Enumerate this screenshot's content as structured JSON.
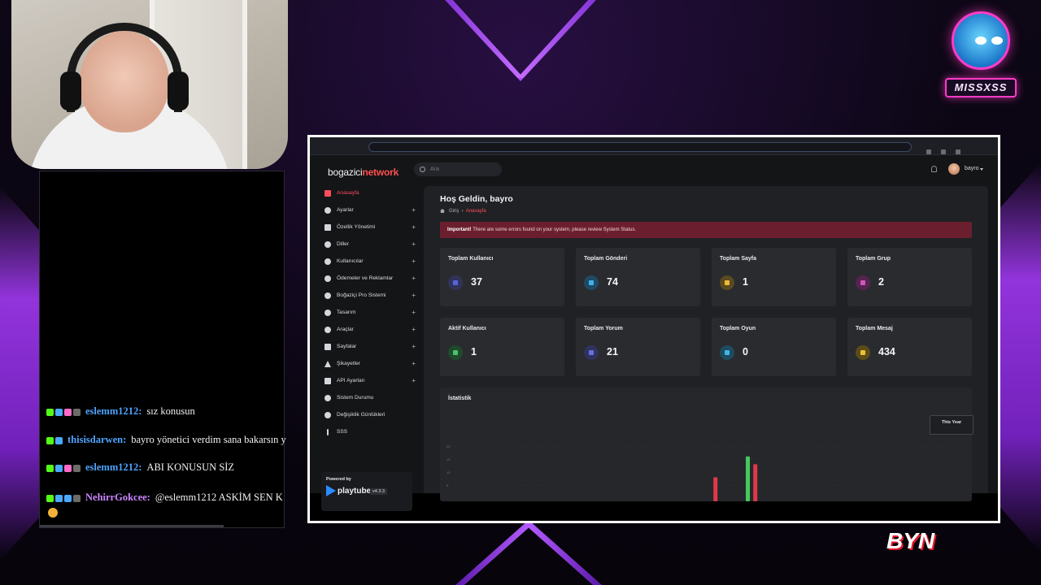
{
  "overlay": {
    "channel_badge": "MISSXSS",
    "brand_corner": "BYN"
  },
  "chat": [
    {
      "user": "eslemm1212:",
      "user_color": "#4fa3ff",
      "text": "sız konusun",
      "badges": [
        "k",
        "sw",
        "h",
        "g"
      ]
    },
    {
      "user": "thisisdarwen:",
      "user_color": "#4fa3ff",
      "text": "bayro yönetici verdim sana bakarsın y",
      "badges": [
        "k",
        "sw"
      ]
    },
    {
      "user": "eslemm1212:",
      "user_color": "#4fa3ff",
      "text": "ABI KONUSUN SİZ",
      "badges": [
        "k",
        "sw",
        "h",
        "g"
      ]
    },
    {
      "user": "NehirrGokcee:",
      "user_color": "#c987ff",
      "text": "@eslemm1212 ASKİM SEN K",
      "badges": [
        "k",
        "sw",
        "sw",
        "g"
      ]
    }
  ],
  "app": {
    "brand_prefix": "bogazici",
    "brand_suffix": "network",
    "search_placeholder": "Ara",
    "user_name": "bayro",
    "welcome": "Hoş Geldin, bayro",
    "crumb_root": "Giriş",
    "crumb_current": "Anasayfa",
    "alert_strong": "Important!",
    "alert_text": "There are some errors found on your system, please review System Status.",
    "sidebar": [
      {
        "label": "Anasayfa",
        "plus": false,
        "active": true
      },
      {
        "label": "Ayarlar",
        "plus": true
      },
      {
        "label": "Özellik Yönetimi",
        "plus": true
      },
      {
        "label": "Diller",
        "plus": true
      },
      {
        "label": "Kullanıcılar",
        "plus": true
      },
      {
        "label": "Ödemeler ve Reklamlar",
        "plus": true
      },
      {
        "label": "Boğaziçi Pro Sistemi",
        "plus": true
      },
      {
        "label": "Tasarım",
        "plus": true
      },
      {
        "label": "Araçlar",
        "plus": true
      },
      {
        "label": "Sayfalar",
        "plus": true
      },
      {
        "label": "Şikayetler",
        "plus": true
      },
      {
        "label": "API Ayarları",
        "plus": true
      },
      {
        "label": "Sistem Durumu",
        "plus": false
      },
      {
        "label": "Değişiklik Günlükleri",
        "plus": false
      },
      {
        "label": "SSS",
        "plus": false
      }
    ],
    "powered_by": "Powered by",
    "playtube_name": "playtube",
    "playtube_version": "v4.3.3",
    "cards": [
      {
        "title": "Toplam Kullanıcı",
        "value": "37",
        "color": "#5a64d8",
        "bg": "#30335a"
      },
      {
        "title": "Toplam Gönderi",
        "value": "74",
        "color": "#3fb1f0",
        "bg": "#1f4a63"
      },
      {
        "title": "Toplam Sayfa",
        "value": "1",
        "color": "#f0b93a",
        "bg": "#5a4a1f"
      },
      {
        "title": "Toplam Grup",
        "value": "2",
        "color": "#d157b8",
        "bg": "#55244f"
      },
      {
        "title": "Aktif Kullanıcı",
        "value": "1",
        "color": "#4cc26a",
        "bg": "#1f4a2c"
      },
      {
        "title": "Toplam Yorum",
        "value": "21",
        "color": "#6a6fe0",
        "bg": "#30325e"
      },
      {
        "title": "Toplam Oyun",
        "value": "0",
        "color": "#3fb7e6",
        "bg": "#1e4b5e"
      },
      {
        "title": "Toplam Mesaj",
        "value": "434",
        "color": "#e9c23a",
        "bg": "#5c4c17"
      }
    ],
    "stats_title": "İstatistik",
    "year_button": "This Year"
  },
  "chart_data": {
    "type": "bar",
    "title": "İstatistik",
    "ytick_labels": [
      "20",
      "15",
      "10",
      "5"
    ],
    "series": [
      {
        "color": "#e0394a",
        "bars": [
          {
            "slot": 0.52,
            "value": 8
          },
          {
            "slot": 0.6,
            "value": 13
          }
        ]
      },
      {
        "color": "#45c95c",
        "bars": [
          {
            "slot": 0.585,
            "value": 16
          }
        ]
      }
    ],
    "ylim": [
      0,
      20
    ]
  }
}
